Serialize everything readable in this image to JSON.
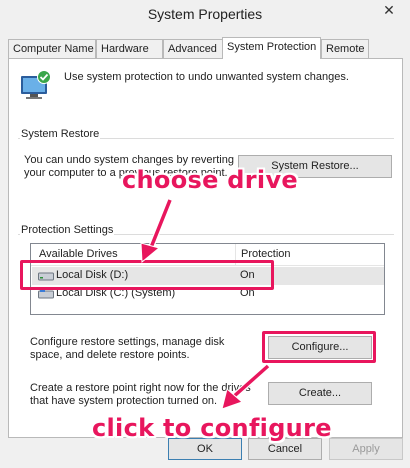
{
  "window": {
    "title": "System Properties",
    "close_glyph": "✕"
  },
  "tabs": [
    {
      "label": "Computer Name"
    },
    {
      "label": "Hardware"
    },
    {
      "label": "Advanced"
    },
    {
      "label": "System Protection",
      "active": true
    },
    {
      "label": "Remote"
    }
  ],
  "intro": {
    "text": "Use system protection to undo unwanted system changes.",
    "icon": "shield-computer-icon"
  },
  "restore": {
    "group_title": "System Restore",
    "description": "You can undo system changes by reverting your computer to a previous restore point.",
    "button": "System Restore..."
  },
  "protection": {
    "group_title": "Protection Settings",
    "columns": [
      "Available Drives",
      "Protection"
    ],
    "drives": [
      {
        "name": "Local Disk (D:)",
        "protection": "On",
        "selected": true
      },
      {
        "name": "Local Disk (C:) (System)",
        "protection": "On",
        "selected": false
      }
    ],
    "configure_text": "Configure restore settings, manage disk space, and delete restore points.",
    "configure_button": "Configure...",
    "create_text": "Create a restore point right now for the drives that have system protection turned on.",
    "create_button": "Create..."
  },
  "footer": {
    "ok": "OK",
    "cancel": "Cancel",
    "apply": "Apply"
  },
  "annotations": {
    "choose_drive": "choose drive",
    "click_configure": "click to configure",
    "color": "#e8165d"
  }
}
